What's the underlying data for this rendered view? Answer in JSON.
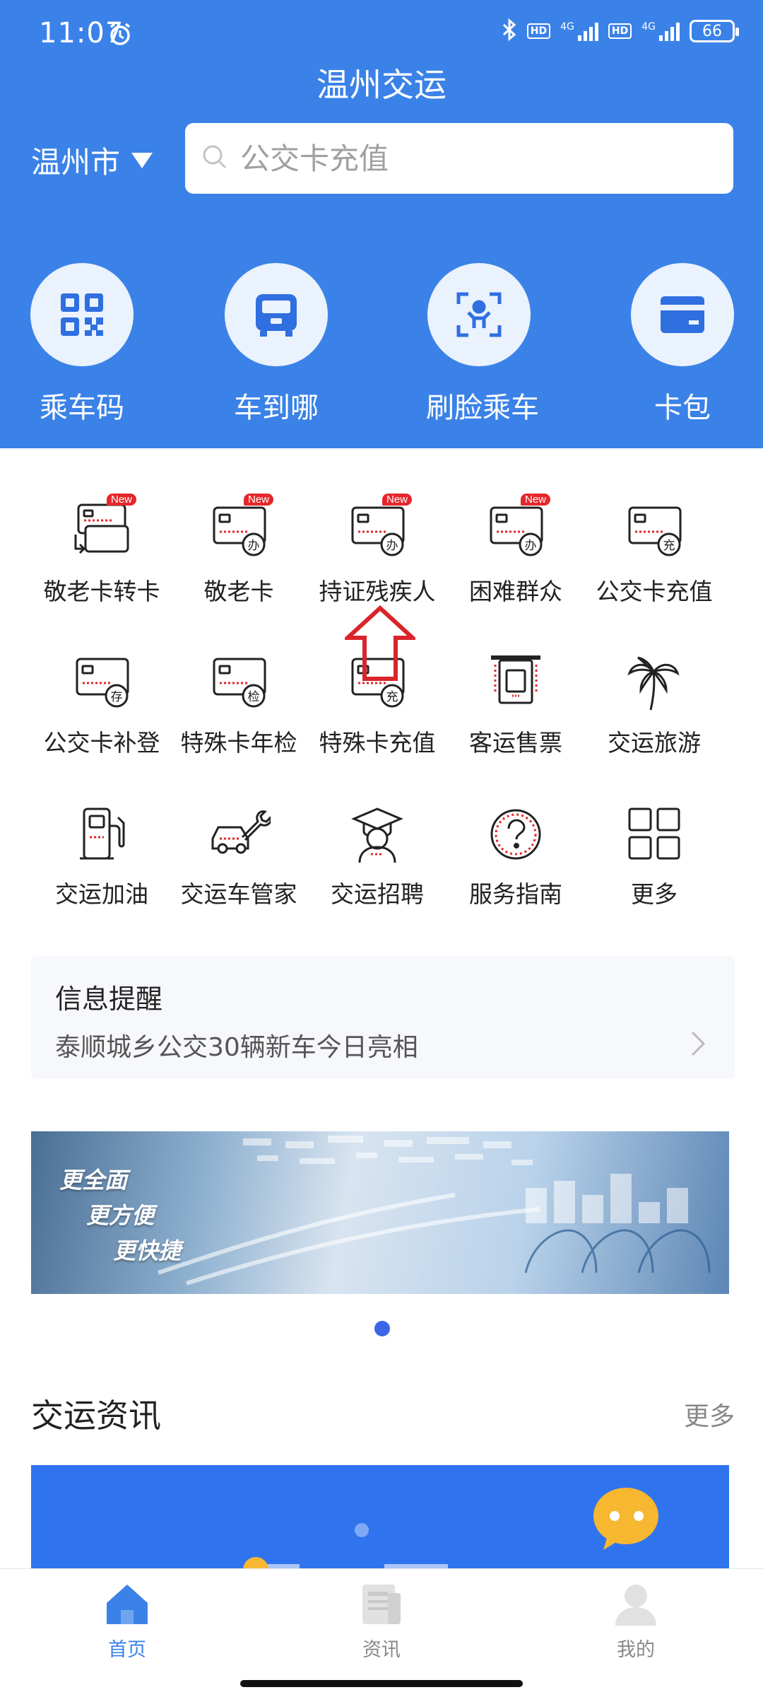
{
  "status_bar": {
    "time": "11:07",
    "battery": "66",
    "net1": "4G",
    "net2": "4G",
    "hd": "HD"
  },
  "header": {
    "title": "温州交运",
    "city": "温州市",
    "search_placeholder": "公交卡充值"
  },
  "quick_actions": [
    {
      "label": "乘车码",
      "icon": "qr-code-icon"
    },
    {
      "label": "车到哪",
      "icon": "bus-icon"
    },
    {
      "label": "刷脸乘车",
      "icon": "face-scan-icon"
    },
    {
      "label": "卡包",
      "icon": "card-wallet-icon"
    }
  ],
  "grid": [
    {
      "label": "敬老卡转卡",
      "badge": "New"
    },
    {
      "label": "敬老卡",
      "badge": "New",
      "tag": "办"
    },
    {
      "label": "持证残疾人",
      "badge": "New",
      "tag": "办"
    },
    {
      "label": "困难群众",
      "badge": "New",
      "tag": "办"
    },
    {
      "label": "公交卡充值",
      "tag": "充"
    },
    {
      "label": "公交卡补登",
      "tag": "存"
    },
    {
      "label": "特殊卡年检",
      "tag": "检"
    },
    {
      "label": "特殊卡充值",
      "tag": "充"
    },
    {
      "label": "客运售票"
    },
    {
      "label": "交运旅游"
    },
    {
      "label": "交运加油"
    },
    {
      "label": "交运车管家"
    },
    {
      "label": "交运招聘"
    },
    {
      "label": "服务指南"
    },
    {
      "label": "更多"
    }
  ],
  "info": {
    "heading": "信息提醒",
    "message": "泰顺城乡公交30辆新车今日亮相"
  },
  "banner": {
    "line1": "更全面",
    "line2": "更方便",
    "line3": "更快捷"
  },
  "news": {
    "title": "交运资讯",
    "more": "更多"
  },
  "tabs": [
    {
      "label": "首页",
      "active": true
    },
    {
      "label": "资讯",
      "active": false
    },
    {
      "label": "我的",
      "active": false
    }
  ],
  "colors": {
    "primary": "#3b82e8",
    "badge_red": "#e5262a",
    "arrow_red": "#d9252a"
  }
}
